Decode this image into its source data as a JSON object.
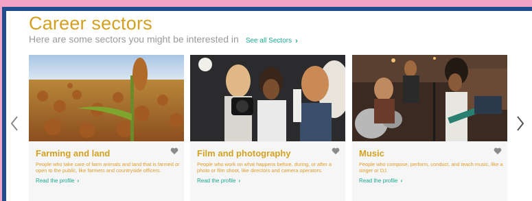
{
  "header": {
    "title": "Career sectors",
    "subtitle": "Here are some sectors you might be interested in",
    "see_all_label": "See all Sectors",
    "see_all_chevron": "›"
  },
  "carousel": {
    "prev_icon": "chevron-left-icon",
    "next_icon": "chevron-right-icon"
  },
  "cards": [
    {
      "title": "Farming and land",
      "description": "People who take care of farm animals and land that is farmed or open to the public, like farmers and countryside officers.",
      "link_label": "Read the profile",
      "chevron": "›",
      "icon": "heart-icon"
    },
    {
      "title": "Film and photography",
      "description": "People who work on what happens before, during, or after a photo or film shoot, like directors and camera operators.",
      "link_label": "Read the profile",
      "chevron": "›",
      "icon": "heart-icon"
    },
    {
      "title": "Music",
      "description": "People who compose, perform, conduct, and teach music, like a singer or DJ.",
      "link_label": "Read the profile",
      "chevron": "›",
      "icon": "heart-icon"
    }
  ],
  "colors": {
    "background": "#f2a3c6",
    "frame": "#1f4e8f",
    "accent": "#d4a020",
    "link": "#1aa88f",
    "muted": "#9a9a9a"
  }
}
